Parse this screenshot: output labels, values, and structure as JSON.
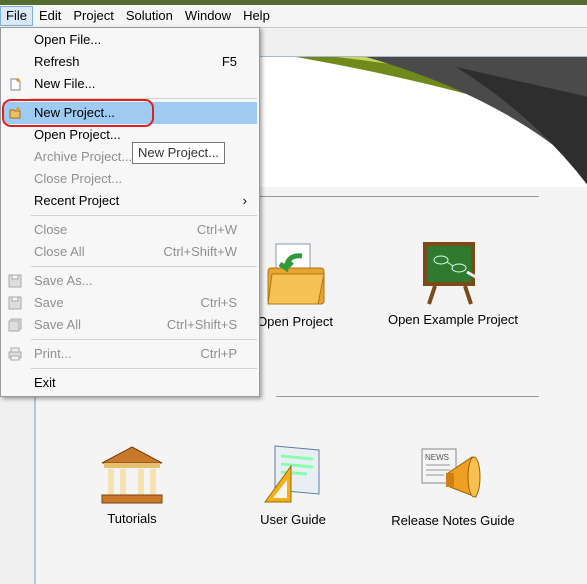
{
  "menubar": [
    "File",
    "Edit",
    "Project",
    "Solution",
    "Window",
    "Help"
  ],
  "file_menu": {
    "open_file": "Open File...",
    "refresh": "Refresh",
    "refresh_accel": "F5",
    "new_file": "New File...",
    "new_project": "New Project...",
    "open_project": "Open Project...",
    "archive_project": "Archive Project...",
    "close_project": "Close Project...",
    "recent_project": "Recent Project",
    "close": "Close",
    "close_accel": "Ctrl+W",
    "close_all": "Close All",
    "close_all_accel": "Ctrl+Shift+W",
    "save_as": "Save As...",
    "save": "Save",
    "save_accel": "Ctrl+S",
    "save_all": "Save All",
    "save_all_accel": "Ctrl+Shift+S",
    "print": "Print...",
    "print_accel": "Ctrl+P",
    "exit": "Exit"
  },
  "tooltip": "New Project...",
  "welcome": {
    "open_project": "Open Project",
    "open_example_project": "Open Example Project",
    "tutorials": "Tutorials",
    "user_guide": "User Guide",
    "release_notes_guide": "Release Notes Guide"
  },
  "colors": {
    "highlight": "#9fcbf2",
    "callout_ring": "#e02020",
    "disabled_text": "#8f8f8f"
  }
}
